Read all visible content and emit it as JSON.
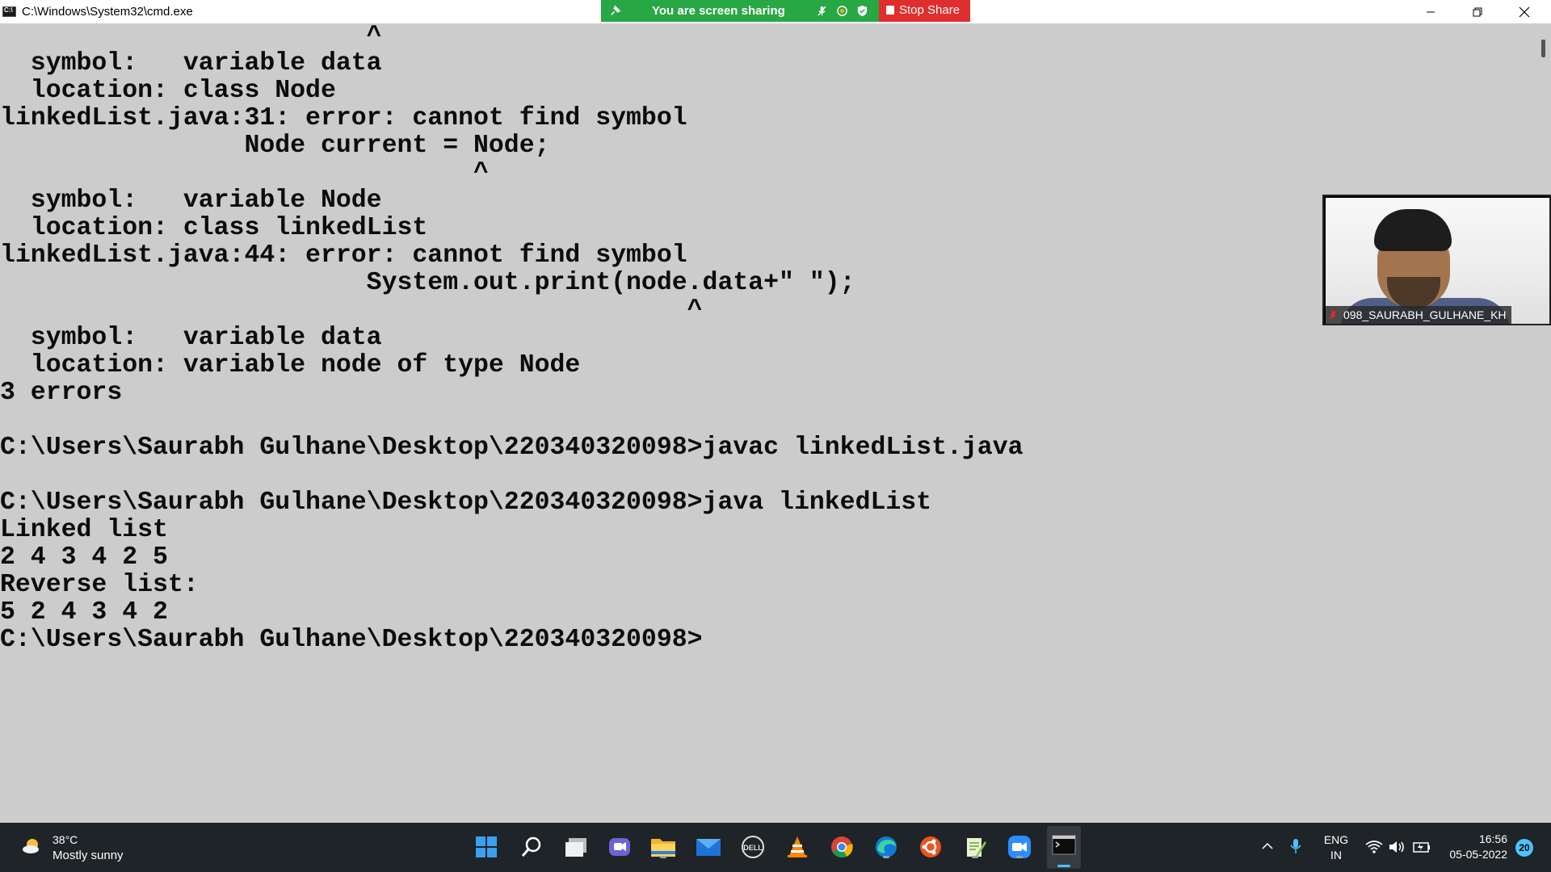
{
  "window": {
    "title": "C:\\Windows\\System32\\cmd.exe",
    "controls": {
      "minimize": "—",
      "restore": "❐",
      "close": "✕"
    }
  },
  "share_banner": {
    "text": "You are screen sharing",
    "stop_label": "Stop Share"
  },
  "console": {
    "lines": [
      "                        ^",
      "  symbol:   variable data",
      "  location: class Node",
      "linkedList.java:31: error: cannot find symbol",
      "                Node current = Node;",
      "                               ^",
      "  symbol:   variable Node",
      "  location: class linkedList",
      "linkedList.java:44: error: cannot find symbol",
      "                        System.out.print(node.data+\" \");",
      "                                             ^",
      "  symbol:   variable data",
      "  location: variable node of type Node",
      "3 errors",
      "",
      "C:\\Users\\Saurabh Gulhane\\Desktop\\220340320098>javac linkedList.java",
      "",
      "C:\\Users\\Saurabh Gulhane\\Desktop\\220340320098>java linkedList",
      "Linked list",
      "2 4 3 4 2 5",
      "Reverse list:",
      "5 2 4 3 4 2",
      "C:\\Users\\Saurabh Gulhane\\Desktop\\220340320098>"
    ]
  },
  "video": {
    "participant_name": "098_SAURABH_GULHANE_KH"
  },
  "taskbar": {
    "weather": {
      "temp": "38°C",
      "desc": "Mostly sunny"
    },
    "apps": [
      "start-icon",
      "search-icon",
      "task-view-icon",
      "teams-chat-icon",
      "file-explorer-icon",
      "mail-icon",
      "dell-icon",
      "vlc-icon",
      "chrome-icon",
      "edge-icon",
      "ubuntu-icon",
      "notepad-plus-plus-icon",
      "zoom-icon",
      "terminal-icon"
    ],
    "lang_line1": "ENG",
    "lang_line2": "IN",
    "time": "16:56",
    "date": "05-05-2022",
    "notifications": "20"
  },
  "colors": {
    "console_bg": "#cccccc",
    "console_fg": "#0c0c0c",
    "share_green": "#28a745",
    "stop_red": "#e02d2d",
    "taskbar_bg": "#1f2428"
  }
}
